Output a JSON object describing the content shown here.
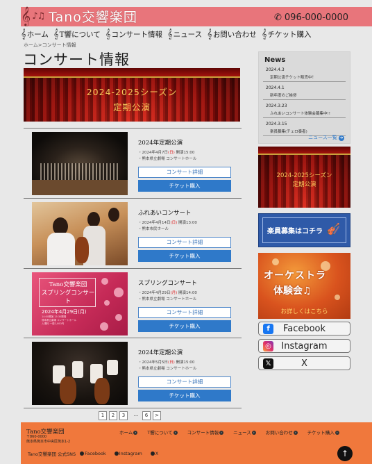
{
  "header": {
    "site_name": "Tano交響楽団",
    "logo_glyphs": "𝄞",
    "logo_notes": "♪♫",
    "phone": "096-000-0000",
    "phone_icon": "phone-icon"
  },
  "nav": [
    {
      "label": "ホーム",
      "icon": "treble-clef-icon"
    },
    {
      "label": "T響について",
      "icon": "treble-clef-icon"
    },
    {
      "label": "コンサート情報",
      "icon": "treble-clef-icon"
    },
    {
      "label": "ニュース",
      "icon": "treble-clef-icon"
    },
    {
      "label": "お問い合わせ",
      "icon": "treble-clef-icon"
    },
    {
      "label": "チケット購入",
      "icon": "treble-clef-icon"
    }
  ],
  "breadcrumb": "ホーム>コンサート情報",
  "page_title": "コンサート情報",
  "hero": {
    "line1": "2024-2025シーズン",
    "line2": "定期公演"
  },
  "concerts": [
    {
      "title": "2024年定期公演",
      "date_pre": "・2024年4月7日",
      "day": "(日)",
      "date_post": " 開演15:00",
      "venue": "・熊本県立劇場 コンサートホール",
      "detail_label": "コンサート詳細",
      "ticket_label": "チケット購入"
    },
    {
      "title": "ふれあいコンサート",
      "date_pre": "・2024年4月14日",
      "day": "(日)",
      "date_post": " 開演13:00",
      "venue": "・熊本市民ホール",
      "detail_label": "コンサート詳細",
      "ticket_label": "チケット購入"
    },
    {
      "title": "スプリングコンサート",
      "date_pre": "・2024年4月29日",
      "day": "(月)",
      "date_post": " 開演14:00",
      "venue": "・熊本県立劇場 コンサートホール",
      "detail_label": "コンサート詳細",
      "ticket_label": "チケット購入",
      "poster": {
        "title1": "Tano交響楽団",
        "title2": "スプリングコンサート",
        "date": "2024年4月29日(月)",
        "small": "14:00開演 13:30開場\n熊本県立劇場 コンサートホール\n入場料 一般2,000円"
      }
    },
    {
      "title": "2024年定期公演",
      "date_pre": "・2024年5月5日",
      "day": "(日)",
      "date_post": " 開演15:00",
      "venue": "・熊本県立劇場 コンサートホール",
      "detail_label": "コンサート詳細",
      "ticket_label": "チケット購入"
    }
  ],
  "pagination": [
    "1",
    "2",
    "3",
    "...",
    "6",
    ">"
  ],
  "news": {
    "title": "News",
    "items": [
      {
        "date": "2024.4.3",
        "text": "定期公演チケット販売中！"
      },
      {
        "date": "2024.4.1",
        "text": "新年度のご挨拶"
      },
      {
        "date": "2024.3.23",
        "text": "ふれあいコンサート体験会募集中!!"
      },
      {
        "date": "2024.3.15",
        "text": "楽員募集(チェロ奏者)"
      }
    ],
    "more_label": "ニュース一覧"
  },
  "side_banners": {
    "season_line1": "2024-2025シーズン",
    "season_line2": "定期公演",
    "recruit": "楽員募集はコチラ",
    "recruit_icon": "violin-icon",
    "trial_line1": "オーケストラ",
    "trial_line2": "体験会♫",
    "trial_line3": "お詳しくはこちら"
  },
  "social": {
    "facebook": "Facebook",
    "instagram": "Instagram",
    "x": "X"
  },
  "footer": {
    "name": "Tano交響楽団",
    "postal": "〒860-0000",
    "address": "熊本県熊本市中央区熊本1-2",
    "nav": [
      "ホーム",
      "T響について",
      "コンサート情報",
      "ニュース",
      "お問い合わせ",
      "チケット購入"
    ],
    "sns_title": "Tano交響楽団 公式SNS",
    "sns_fb": "Facebook",
    "sns_ig": "Instagram",
    "sns_x": "X",
    "to_top": "↑"
  },
  "colors": {
    "header_bg": "#e8757b",
    "footer_bg": "#f0783c",
    "primary_button": "#2f79c9",
    "page_bg": "#e8e8e8"
  }
}
